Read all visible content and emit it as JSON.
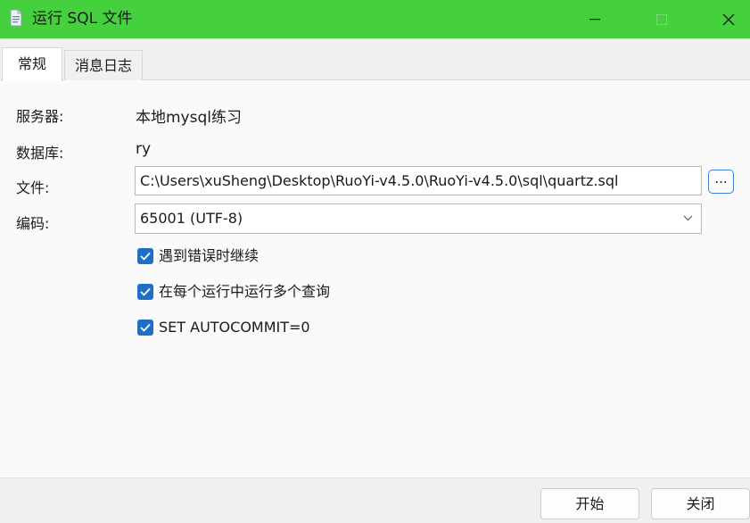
{
  "window": {
    "title": "运行 SQL 文件",
    "icon": "document-icon",
    "controls": {
      "minimize": "minimize-icon",
      "maximize": "maximize-icon",
      "close": "close-icon"
    },
    "accent_color": "#45d13e"
  },
  "tabs": [
    {
      "label": "常规",
      "active": true
    },
    {
      "label": "消息日志",
      "active": false
    }
  ],
  "form": {
    "server": {
      "label": "服务器:",
      "value": "本地mysql练习"
    },
    "database": {
      "label": "数据库:",
      "value": "ry"
    },
    "file": {
      "label": "文件:",
      "value": "C:\\Users\\xuSheng\\Desktop\\RuoYi-v4.5.0\\RuoYi-v4.5.0\\sql\\quartz.sql",
      "browse_label": "..."
    },
    "encoding": {
      "label": "编码:",
      "value": "65001 (UTF-8)"
    }
  },
  "options": [
    {
      "label": "遇到错误时继续",
      "checked": true
    },
    {
      "label": "在每个运行中运行多个查询",
      "checked": true
    },
    {
      "label": "SET AUTOCOMMIT=0",
      "checked": true
    }
  ],
  "buttons": {
    "start": "开始",
    "close": "关闭"
  },
  "colors": {
    "checkbox": "#1f6fc8",
    "browse_border": "#3b7fd6"
  }
}
